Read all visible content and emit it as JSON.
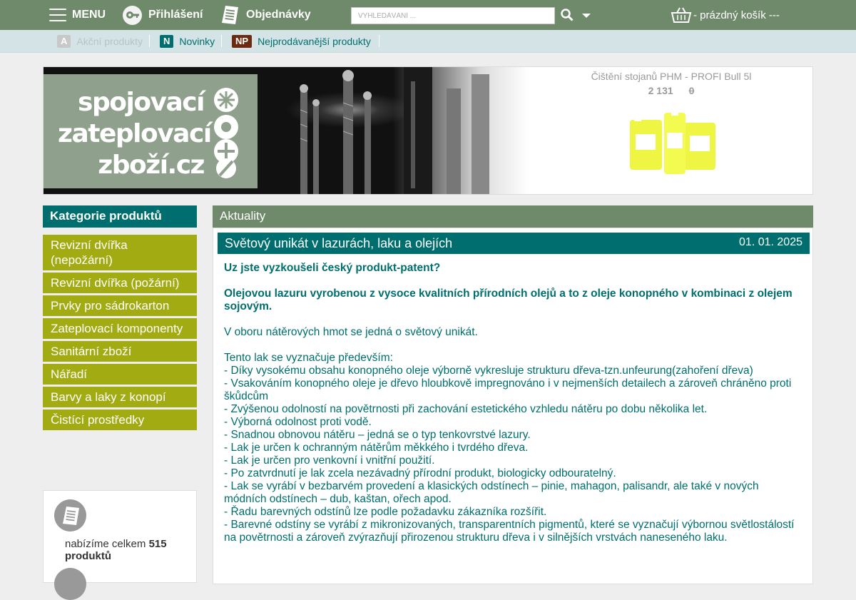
{
  "topbar": {
    "menu_label": "MENU",
    "login_label": "Přihlášení",
    "orders_label": "Objednávky",
    "search_placeholder": "VYHLEDÁVÁNÍ ...",
    "cart_label": "- prázdný košík ---"
  },
  "subbar": {
    "items": [
      {
        "badge": "A",
        "label": "Akční produkty",
        "badge_color": "#c8c8c8",
        "text_color": "#c0c8c8"
      },
      {
        "badge": "N",
        "label": "Novinky",
        "badge_color": "#006e6e",
        "text_color": "#006e6e"
      },
      {
        "badge": "NP",
        "label": "Nejprodávanější produkty",
        "badge_color": "#7a2a10",
        "text_color": "#006e6e"
      }
    ]
  },
  "banner": {
    "logo_lines": [
      "spojovací",
      "zateplovací",
      "zboží.cz"
    ],
    "promo_title": "Čištění stojanů PHM - PROFI Bull 5l",
    "promo_price": "2 131",
    "promo_old_price": "0"
  },
  "categories": {
    "title": "Kategorie produktů",
    "items": [
      "Revizní dvířka (nepožární)",
      "Revizní dvířka (požární)",
      "Prvky pro sádrokarton",
      "Zateplovací komponenty",
      "Sanitární zboží",
      "Nářadí",
      "Barvy a laky z konopí",
      "Čistící prostředky"
    ]
  },
  "stats": {
    "prefix": "nabízíme celkem",
    "count": "515",
    "suffix": "produktů"
  },
  "news": {
    "title": "Aktuality",
    "article": {
      "title": "Světový unikát v lazurách, laku a olejích",
      "date": "01. 01. 2025",
      "bold_1": "Uz jste vyzkoušeli český produkt-patent?",
      "bold_2": "Olejovou lazuru vyrobenou z vysoce kvalitních přírodních olejů a to z oleje konopného v kombinaci z olejem sojovým.",
      "para_1": "V oboru nátěrových hmot se jedná o světový unikát.",
      "lead": "Tento lak se vyznačuje především:",
      "bullets": [
        "- Díky vysokému obsahu konopného oleje výborně vykresluje strukturu dřeva-tzn.unfeurung(zahoření dřeva)",
        "- Vsakováním konopného oleje je dřevo hloubkově impregnováno i v nejmenších detailech a zároveň chráněno proti škůdcům",
        "- Zvýšenou odolností na povětrnosti při zachování estetického vzhledu nátěru po dobu několika let.",
        "- Výborná odolnost proti vodě.",
        "- Snadnou obnovou nátěru – jedná se o typ tenkovrstvé lazury.",
        "- Lak je určen k ochranným nátěrům měkkého i tvrdého dřeva.",
        "- Lak je určen pro venkovní i vnitřní použití.",
        "- Po zatvrdnutí je lak zcela nezávadný přírodní produkt, biologicky odbouratelný.",
        "- Lak se vyrábí v bezbarvém provedení a klasických odstínech – pinie, mahagon, palisandr, ale také v nových módních odstínech – dub, kaštan, ořech apod.",
        "- Řadu barevných odstínů lze podle požadavku zákazníka rozšířit.",
        "- Barevné odstíny se vyrábí z mikronizovaných, transparentních pigmentů, které se vyznačují výbornou světlostálostí na povětrnosti a zároveň zvýrazňují přirozenou strukturu dřeva i v silnějších vrstvách naneseného laku."
      ]
    }
  },
  "colors": {
    "topbar": "#6f8a6a",
    "teal": "#006e6e",
    "category_green": "#a3ab12"
  }
}
